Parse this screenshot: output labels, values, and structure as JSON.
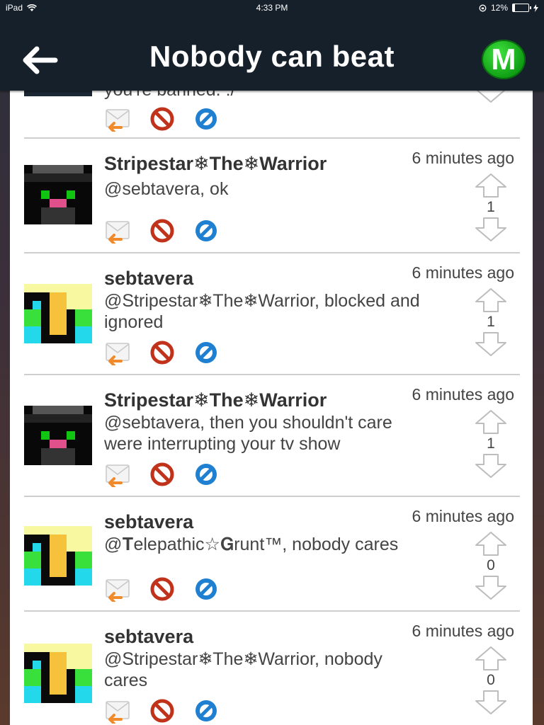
{
  "status_bar": {
    "device": "iPad",
    "time": "4:33 PM",
    "battery": "12%",
    "battery_level": 0.12
  },
  "nav": {
    "title": "Nobody can beat",
    "back_icon": "back-arrow-icon",
    "badge_letter": "M",
    "badge_color": "#19b51d"
  },
  "colors": {
    "header_bg": "#16202b",
    "reply_icon": "#f08a2a",
    "block_icon": "#c0321a",
    "ignore_icon": "#1f7fd0"
  },
  "partial_top": {
    "message": "you're banned. :/"
  },
  "posts": [
    {
      "username": "Stripestar❄The❄Warrior",
      "time": "6 minutes ago",
      "message_lines": [
        "@sebtavera, ok",
        ""
      ],
      "votes": "1",
      "avatar": "black-cat"
    },
    {
      "username": "sebtavera",
      "time": "6 minutes ago",
      "message_lines": [
        "@Stripestar❄The❄Warrior, blocked and",
        "ignored"
      ],
      "votes": "1",
      "avatar": "yellow-blocky"
    },
    {
      "username": "Stripestar❄The❄Warrior",
      "time": "6 minutes ago",
      "message_lines": [
        "@sebtavera, then you shouldn't care",
        "were interrupting your tv show"
      ],
      "votes": "1",
      "avatar": "black-cat"
    },
    {
      "username": "sebtavera",
      "time": "6 minutes ago",
      "message_lines": [
        "@𝐓elepathic☆𝐆runt™, nobody cares",
        ""
      ],
      "votes": "0",
      "avatar": "yellow-blocky"
    },
    {
      "username": "sebtavera",
      "time": "6 minutes ago",
      "message_lines": [
        "@Stripestar❄The❄Warrior, nobody",
        "cares"
      ],
      "votes": "0",
      "avatar": "yellow-blocky"
    }
  ]
}
